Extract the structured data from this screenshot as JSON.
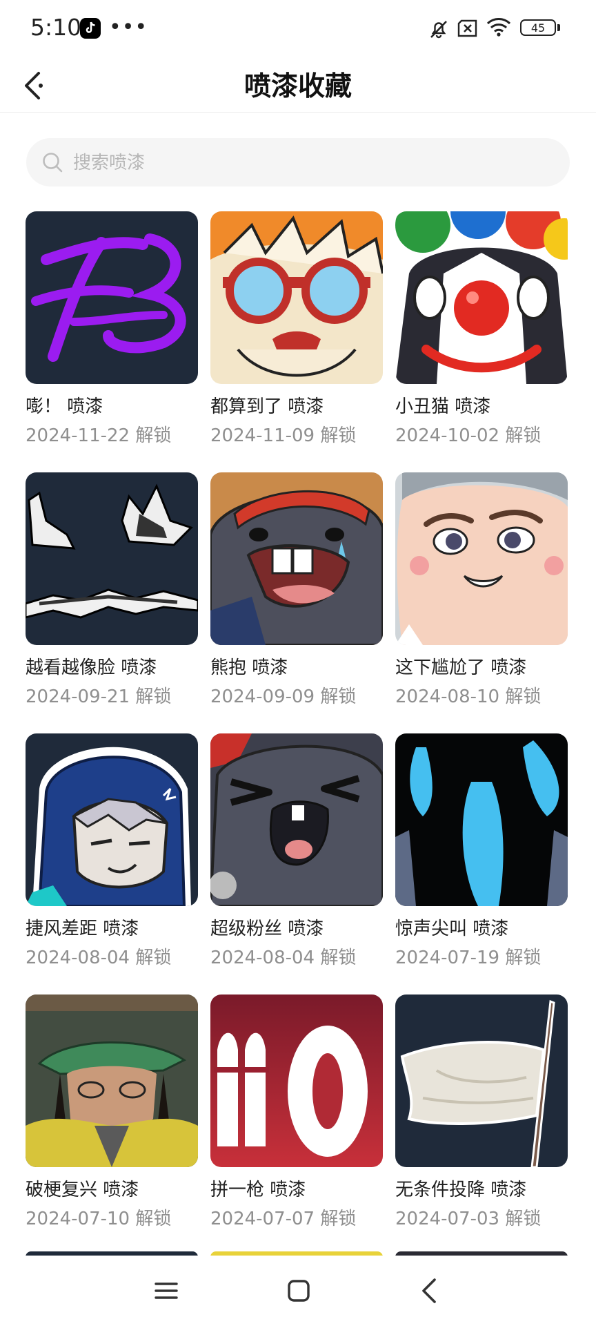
{
  "status_bar": {
    "time": "5:10",
    "battery": "45",
    "icons": [
      "tiktok-icon",
      "more-icon",
      "bell-off-icon",
      "sim-x-icon",
      "wifi-icon",
      "battery-icon"
    ]
  },
  "header": {
    "title": "喷漆收藏",
    "back_icon": "chevron-left-icon"
  },
  "search": {
    "placeholder": "搜索喷漆",
    "value": ""
  },
  "sprays": [
    {
      "name": "嘭！ 喷漆",
      "date": "2024-11-22 解锁"
    },
    {
      "name": "都算到了 喷漆",
      "date": "2024-11-09 解锁"
    },
    {
      "name": "小丑猫 喷漆",
      "date": "2024-10-02 解锁"
    },
    {
      "name": "越看越像脸 喷漆",
      "date": "2024-09-21 解锁"
    },
    {
      "name": "熊抱 喷漆",
      "date": "2024-09-09 解锁"
    },
    {
      "name": "这下尴尬了 喷漆",
      "date": "2024-08-10 解锁"
    },
    {
      "name": "捷风差距 喷漆",
      "date": "2024-08-04 解锁"
    },
    {
      "name": "超级粉丝 喷漆",
      "date": "2024-08-04 解锁"
    },
    {
      "name": "惊声尖叫 喷漆",
      "date": "2024-07-19 解锁"
    },
    {
      "name": "破梗复兴 喷漆",
      "date": "2024-07-10 解锁"
    },
    {
      "name": "拼一枪 喷漆",
      "date": "2024-07-07 解锁"
    },
    {
      "name": "无条件投降 喷漆",
      "date": "2024-07-03 解锁"
    }
  ],
  "nav": {
    "icons": [
      "menu-icon",
      "home-square-icon",
      "back-arrow-icon"
    ]
  },
  "colors": {
    "title_text": "#111111",
    "date_text": "#8f8f8f",
    "search_bg": "#f5f5f5",
    "placeholder": "#b6b6b6"
  }
}
